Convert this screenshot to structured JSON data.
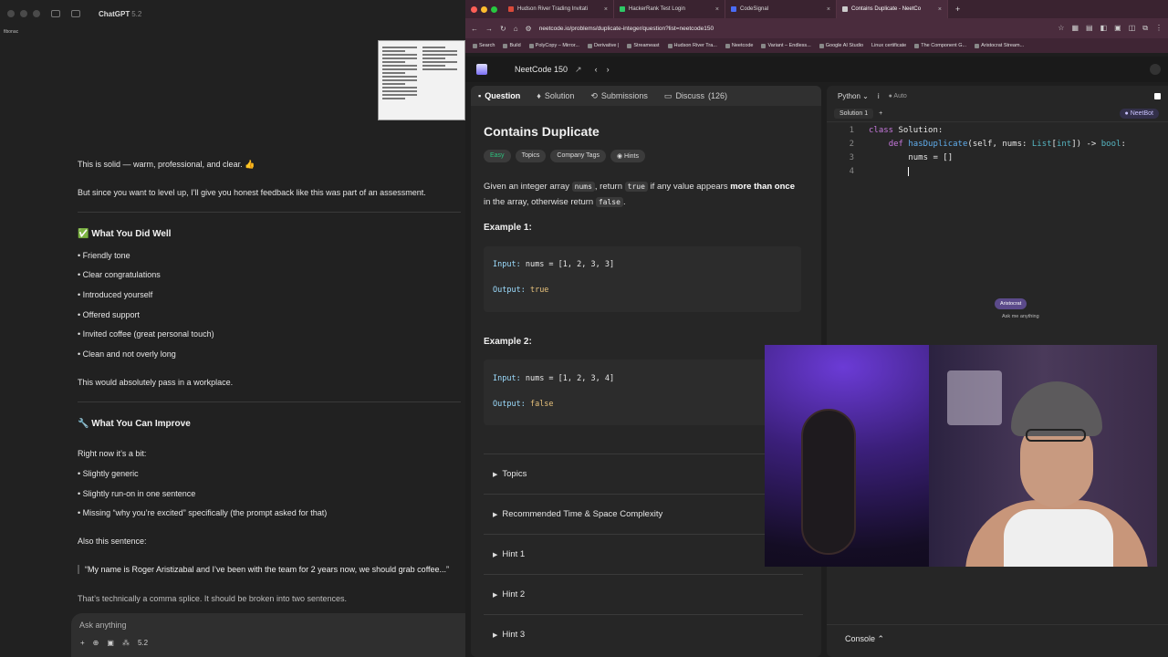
{
  "chat": {
    "app_title": "ChatGPT",
    "version": "5.2",
    "sidebar_hint": "fibonac",
    "messages": [
      "This is solid — warm, professional, and clear. 👍",
      "But since you want to level up, I’ll give you honest feedback like this was part of an assessment."
    ],
    "did_well": {
      "heading": "✅ What You Did Well",
      "items": [
        "• Friendly tone",
        "• Clear congratulations",
        "• Introduced yourself",
        "• Offered support",
        "• Invited coffee (great personal touch)",
        "• Clean and not overly long"
      ],
      "summary": "This would absolutely pass in a workplace."
    },
    "improve": {
      "heading": "🔧 What You Can Improve",
      "intro": "Right now it’s a bit:",
      "items": [
        "• Slightly generic",
        "• Slightly run-on in one sentence",
        "• Missing “why you’re excited” specifically (the prompt asked for that)"
      ],
      "also": "Also this sentence:",
      "quote": "“My name is Roger Aristizabal and I’ve been with the team for 2 years now, we should grab coffee...”",
      "note": "That’s technically a comma splice. It should be broken into two sentences."
    },
    "composer": {
      "placeholder": "Ask anything",
      "model_badge": "5.2"
    }
  },
  "browser": {
    "tabs": [
      {
        "label": "Hudson River Trading Invitati",
        "color": "#d94a3a"
      },
      {
        "label": "HackerRank Test Login",
        "color": "#2ec866"
      },
      {
        "label": "CodeSignal",
        "color": "#4a6cf7"
      },
      {
        "label": "Contains Duplicate - NeetCo",
        "color": "#cccccc",
        "active": true
      }
    ],
    "url": "neetcode.io/problems/duplicate-integer/question?list=neetcode150",
    "bookmarks": [
      "Search",
      "Build",
      "PolyCopy – Mirror...",
      "Derivative |",
      "Streameast",
      "Hudson River Tra...",
      "Neetcode",
      "Variant – Endless...",
      "Google AI Studio",
      "Linux certificate",
      "The Component G...",
      "Aristocrat Stream..."
    ]
  },
  "neetcode": {
    "title": "NeetCode 150",
    "tabs": [
      "Question",
      "Solution",
      "Submissions",
      "Discuss"
    ],
    "discuss_count": "(126)",
    "problem": {
      "title": "Contains Duplicate",
      "chips": [
        "Easy",
        "Topics",
        "Company Tags",
        "Hints"
      ],
      "desc_1": "Given an integer array",
      "code_nums": "nums",
      "desc_2": ", return",
      "code_true": "true",
      "desc_3": "if any value appears",
      "bold_1": "more",
      "bold_2": "than once",
      "desc_4": "in the array, otherwise return",
      "code_false": "false",
      "desc_5": ".",
      "examples": [
        {
          "label": "Example 1:",
          "input_key": "Input:",
          "input_val": "nums = [1, 2, 3, 3]",
          "output_key": "Output:",
          "output_val": "true"
        },
        {
          "label": "Example 2:",
          "input_key": "Input:",
          "input_val": "nums = [1, 2, 3, 4]",
          "output_key": "Output:",
          "output_val": "false"
        }
      ],
      "accordions": [
        "Topics",
        "Recommended Time & Space Complexity",
        "Hint 1",
        "Hint 2",
        "Hint 3"
      ]
    },
    "editor": {
      "language": "Python",
      "auto": "Auto",
      "solution_tab": "Solution 1",
      "bot": "NeetBot",
      "line_numbers": [
        "1",
        "2",
        "3",
        "4"
      ],
      "assistant_pill": "Aristocrat",
      "assistant_sub": "Ask me anything",
      "console": "Console"
    }
  }
}
